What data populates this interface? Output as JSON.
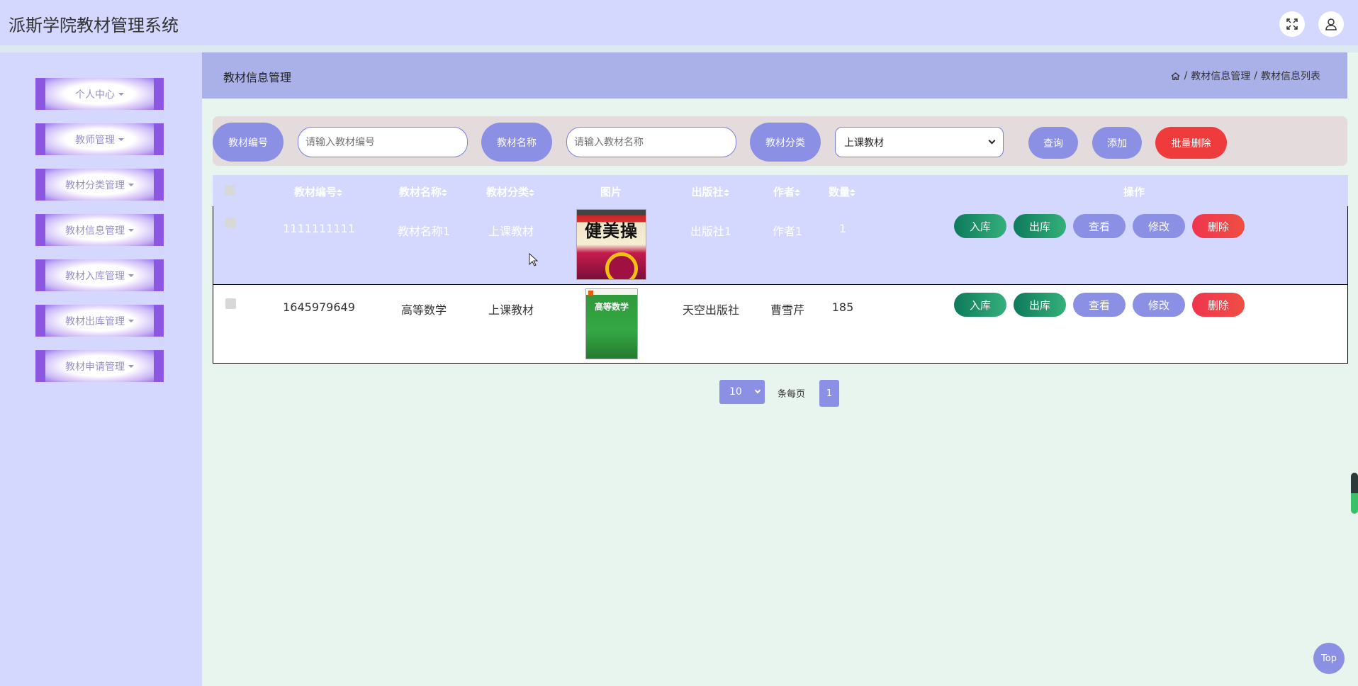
{
  "app": {
    "title": "派斯学院教材管理系统",
    "fullscreen_icon": "expand-icon",
    "user_icon": "user-icon"
  },
  "sidebar": {
    "items": [
      {
        "label": "个人中心"
      },
      {
        "label": "教师管理"
      },
      {
        "label": "教材分类管理"
      },
      {
        "label": "教材信息管理"
      },
      {
        "label": "教材入库管理"
      },
      {
        "label": "教材出库管理"
      },
      {
        "label": "教材申请管理"
      }
    ]
  },
  "header": {
    "page_title": "教材信息管理",
    "breadcrumb": [
      "/",
      "教材信息管理",
      "/",
      "教材信息列表"
    ],
    "home_icon": "home-icon"
  },
  "search": {
    "code_label": "教材编号",
    "code_placeholder": "请输入教材编号",
    "name_label": "教材名称",
    "name_placeholder": "请输入教材名称",
    "category_label": "教材分类",
    "category_selected": "上课教材",
    "query_label": "查询",
    "add_label": "添加",
    "batch_delete_label": "批量删除"
  },
  "table": {
    "columns": [
      "教材编号",
      "教材名称",
      "教材分类",
      "图片",
      "出版社",
      "作者",
      "数量",
      "操作"
    ],
    "rows": [
      {
        "code": "1111111111",
        "name": "教材名称1",
        "category": "上课教材",
        "cover_title": "健美操",
        "publisher": "出版社1",
        "author": "作者1",
        "quantity": "1"
      },
      {
        "code": "1645979649",
        "name": "高等数学",
        "category": "上课教材",
        "cover_title": "高等数学",
        "publisher": "天空出版社",
        "author": "曹雪芹",
        "quantity": "185"
      }
    ],
    "actions": {
      "stock_in": "入库",
      "stock_out": "出库",
      "view": "查看",
      "edit": "修改",
      "delete": "删除"
    }
  },
  "pagination": {
    "page_size": "10",
    "suffix": "条每页",
    "current_page": "1"
  },
  "back_to_top": "Top",
  "colors": {
    "topbar": "#d5d8fe",
    "accent": "#8c90e4",
    "menu_border": "#8b56e0",
    "danger": "#ef3b3b",
    "success": "#13805f",
    "content_bg": "#e8f4ee"
  }
}
